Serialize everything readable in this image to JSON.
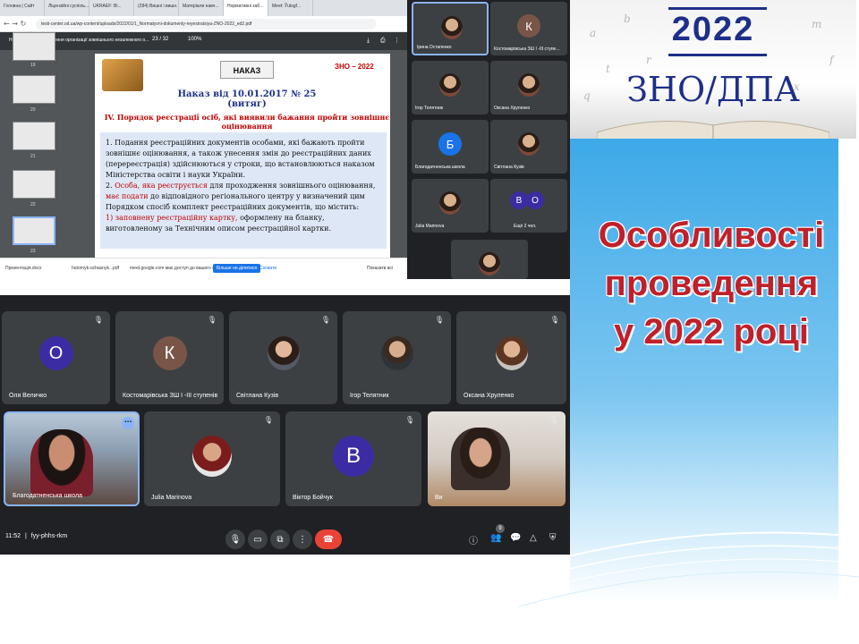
{
  "banner": {
    "year": "2022",
    "subtitle": "ЗНО/ДПА"
  },
  "slide": {
    "title_line1": "Особливості",
    "title_line2": "проведення",
    "title_line3": "у 2022 році"
  },
  "browser": {
    "tabs": [
      "Головна | Сайт",
      "Ліцензійні суспіль...",
      "UKRAEF: Ві...",
      "(284) Вишні і вишн...",
      "Матеріали навч...",
      "Нормативні заб...",
      "Meet: Ўutsgf..."
    ],
    "url": "testi-center.od.ua/wp-content/uploads/2022/01/1_Normatyvni-dokumenty-reyestratsiya-ZNO-2022_ed2.pdf",
    "pdf_title": "Нормативне забезпечення організації зовнішнього незалежного о...",
    "page_indicator": "23 / 32",
    "zoom": "100%",
    "thumb_numbers": [
      "19",
      "20",
      "21",
      "22",
      "23"
    ]
  },
  "pdf_page": {
    "header_badge": "НАКАЗ",
    "zno_logo": "ЗНО – 2022",
    "heading": "Наказ від 10.01.2017 № 25 (витяг)",
    "section": "IV. Порядок реєстрації осіб, які виявили бажання пройти зовнішнє оцінювання",
    "p1_red": "Подання",
    "p1": "1. Подання реєстраційних документів особами, які бажають пройти зовнішнє оцінювання, а також унесення змін до реєстраційних даних (перереєстрація) здійснюються у строки, що встановлюються наказом Міністерства освіти і науки України.",
    "p2_num": "2.",
    "p2_red": "Особа, яка реєструється",
    "p2_mid": "для проходження зовнішнього оцінювання,",
    "p2_red2": "має подати",
    "p2_rest": "до відповідного регіонального центру у визначений цим Порядком спосіб комплект реєстраційних документів, що містить:",
    "p3_red": "1) заповнену реєстраційну картку,",
    "p3_rest": "оформлену на бланку, виготовленому за Технічним описом реєстраційної картки."
  },
  "download_bar": {
    "item1": "Презентація.docx",
    "item2": "hutornyk-uchasnyk...pdf",
    "notice": "meet.google.com має доступ до вашого екрана.",
    "stop_btn": "Більше не ділитися",
    "hide_btn": "Сховати",
    "show_all": "Показати всі"
  },
  "meet_side": {
    "tiles": [
      {
        "name": "Ірина Остапенко",
        "type": "photo",
        "selected": true
      },
      {
        "name": "Костомарівська ЗШ І -ІІІ ступе...",
        "type": "avatar",
        "letter": "К",
        "color": "#795548"
      },
      {
        "name": "Ігор Телятник",
        "type": "photo"
      },
      {
        "name": "Оксана Хруленко",
        "type": "photo"
      },
      {
        "name": "Благодатненська школа",
        "type": "avatar",
        "letter": "Б",
        "color": "#1a73e8"
      },
      {
        "name": "Світлана Кузів",
        "type": "photo"
      },
      {
        "name": "Julia Marinova",
        "type": "photo"
      },
      {
        "name": "Ещё 2 чел.",
        "type": "group",
        "letters": [
          "В",
          "О"
        ]
      }
    ]
  },
  "meet_main": {
    "row1": [
      {
        "name": "Оля Величко",
        "type": "avatar",
        "letter": "О",
        "color": "#3c2ca3"
      },
      {
        "name": "Костомарівська ЗШ І -ІІІ ступенів",
        "type": "avatar",
        "letter": "К",
        "color": "#795548"
      },
      {
        "name": "Світлана Кузів",
        "type": "photo"
      },
      {
        "name": "Ігор Телятник",
        "type": "photo"
      },
      {
        "name": "Оксана Хруленко",
        "type": "photo"
      }
    ],
    "row2": [
      {
        "name": "Благодатненська школа",
        "type": "video"
      },
      {
        "name": "Julia Marinova",
        "type": "photo"
      },
      {
        "name": "Віктор Бойчук",
        "type": "avatar",
        "letter": "В",
        "color": "#3c2ca3"
      },
      {
        "name": "Ви",
        "type": "video"
      }
    ],
    "time": "11:52",
    "meeting_code": "fyy-phhs-rkm",
    "participants_badge": "9"
  }
}
